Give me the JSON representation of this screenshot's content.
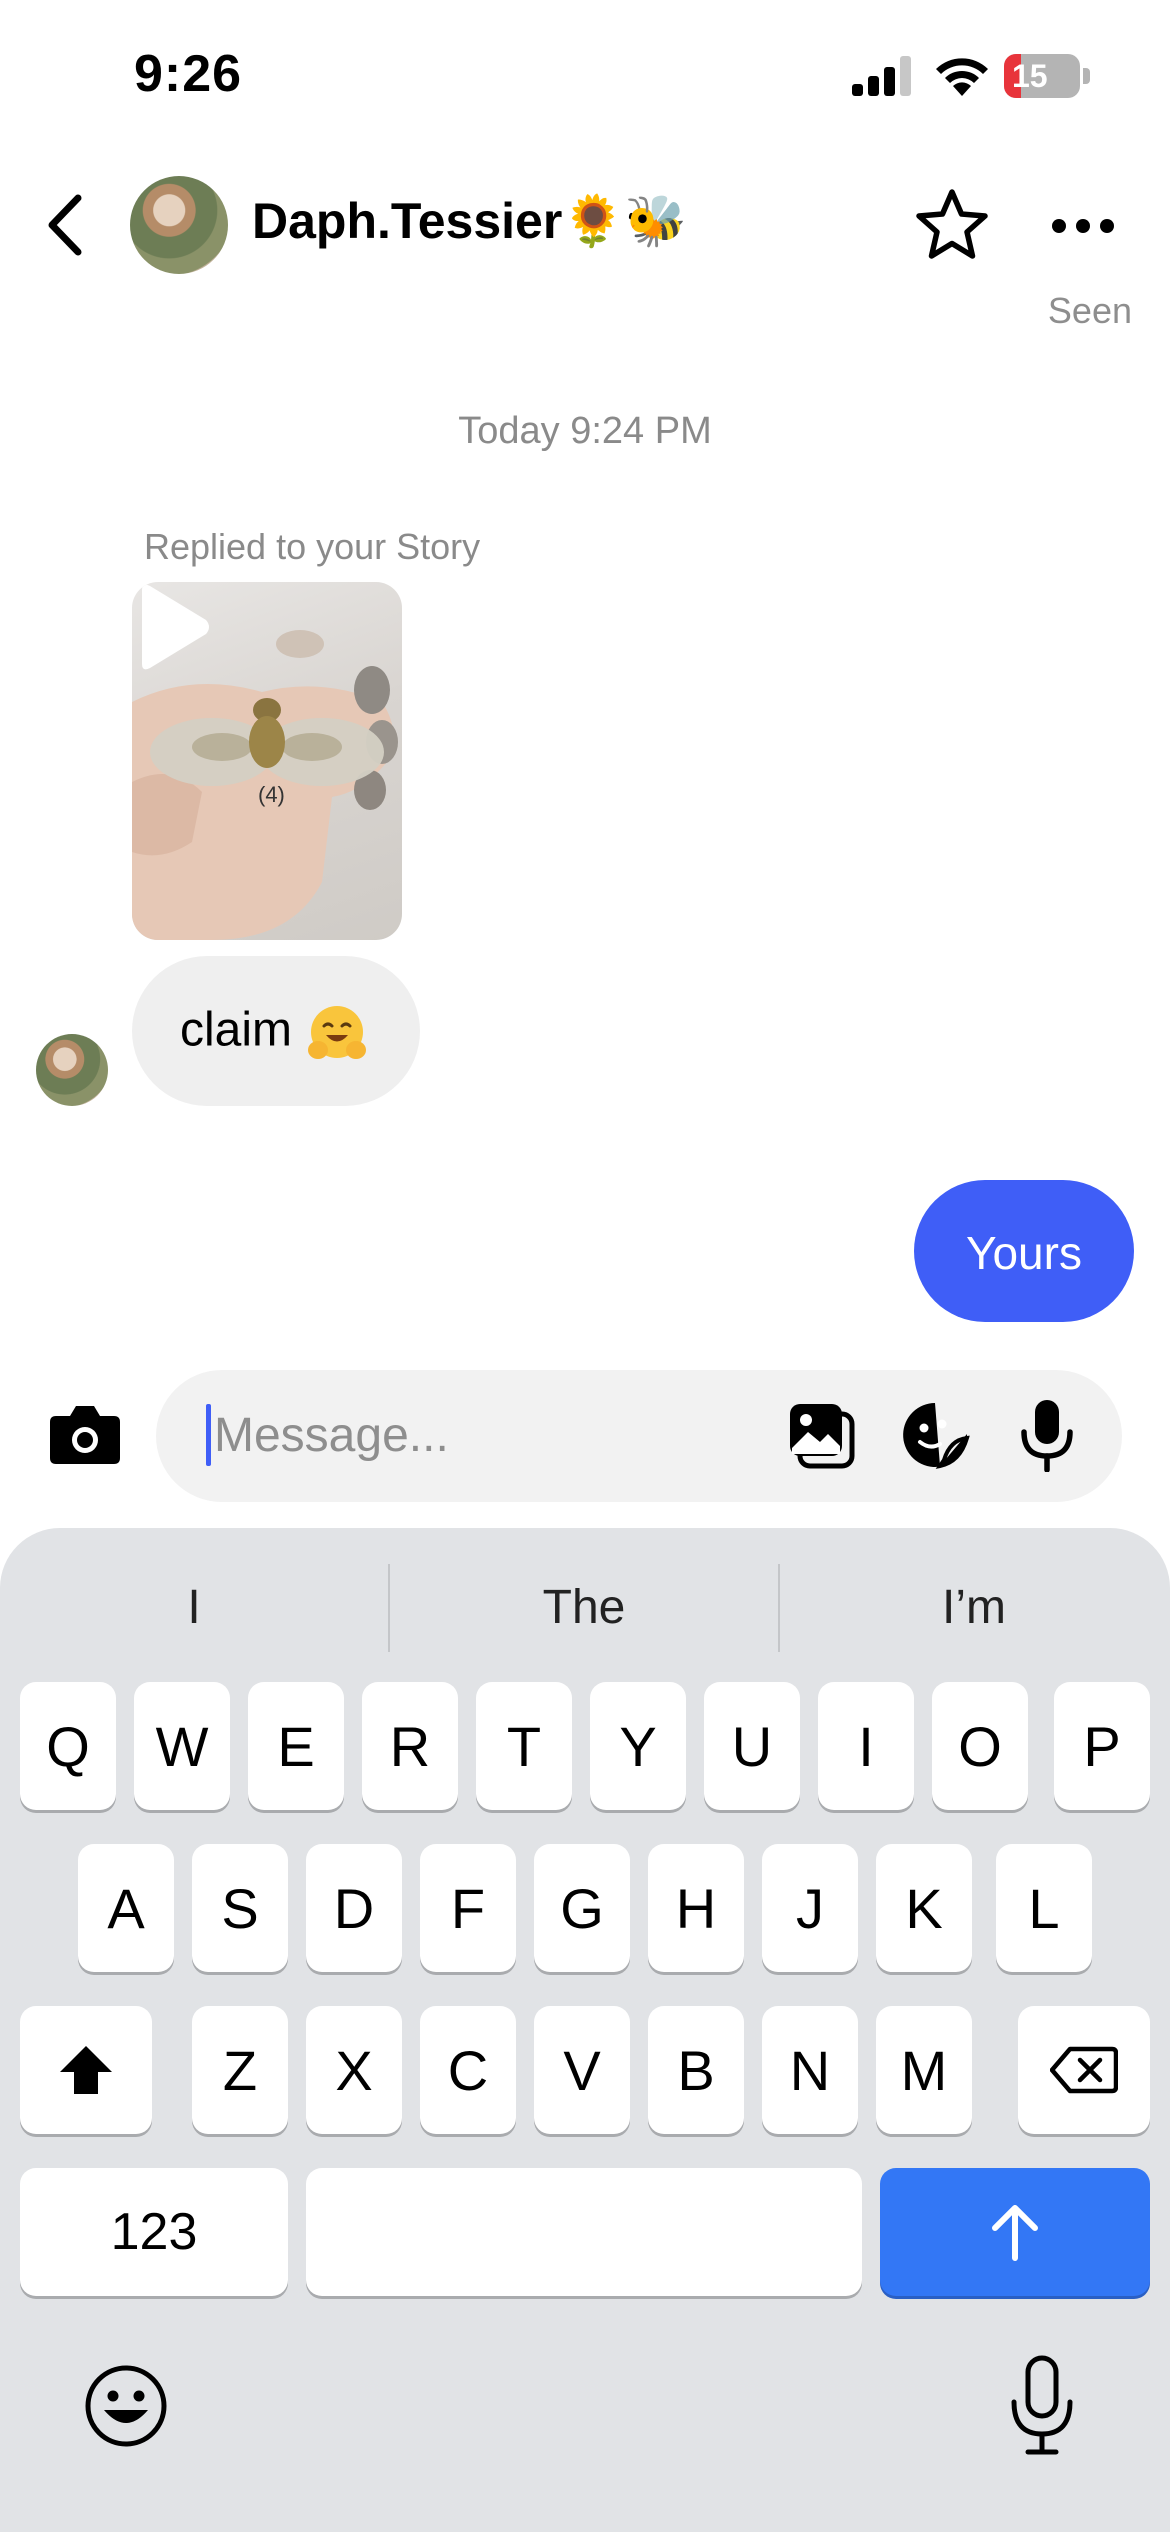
{
  "status_bar": {
    "time": "9:26",
    "battery": "15"
  },
  "header": {
    "contact_name": "Daph.Tessier🌻🐝"
  },
  "chat": {
    "seen": "Seen",
    "timestamp": "Today 9:24 PM",
    "story_reply_label": "Replied to your Story",
    "story_tag": "(4)",
    "incoming_message": "claim",
    "outgoing_message": "Yours"
  },
  "composer": {
    "placeholder": "Message..."
  },
  "keyboard": {
    "suggestions": [
      "I",
      "The",
      "I’m"
    ],
    "row1": [
      "Q",
      "W",
      "E",
      "R",
      "T",
      "Y",
      "U",
      "I",
      "O",
      "P"
    ],
    "row2": [
      "A",
      "S",
      "D",
      "F",
      "G",
      "H",
      "J",
      "K",
      "L"
    ],
    "row3": [
      "Z",
      "X",
      "C",
      "V",
      "B",
      "N",
      "M"
    ],
    "numbers_label": "123"
  },
  "colors": {
    "accent": "#3f5ef7",
    "send_key": "#3377f5",
    "battery_low": "#e8343b"
  }
}
